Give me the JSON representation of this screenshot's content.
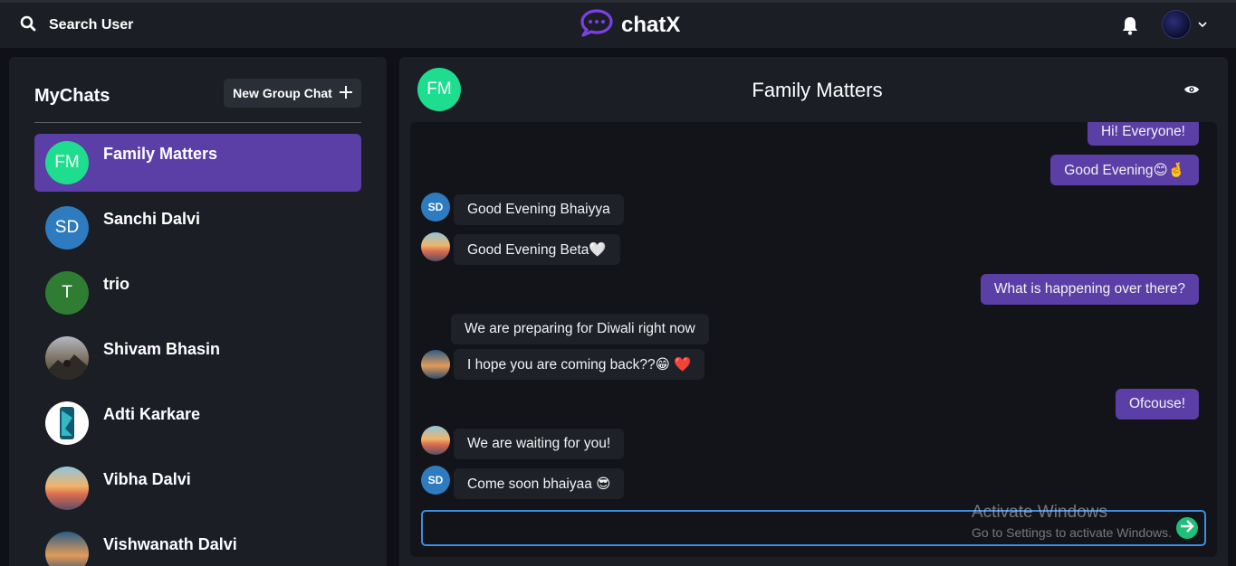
{
  "topbar": {
    "search_label": "Search User",
    "brand_name": "chatX",
    "brand_color": "#7b3fe4"
  },
  "sidebar": {
    "title": "MyChats",
    "new_group_label": "New Group Chat",
    "chats": [
      {
        "name": "Family Matters",
        "initials": "FM",
        "avatar_color": "#1fdd8e",
        "active": true
      },
      {
        "name": "Sanchi Dalvi",
        "initials": "SD",
        "avatar_color": "#2e7bbf",
        "active": false
      },
      {
        "name": "trio",
        "initials": "T",
        "avatar_color": "#2e7d32",
        "active": false
      },
      {
        "name": "Shivam Bhasin",
        "initials": "",
        "avatar_color": "",
        "active": false
      },
      {
        "name": "Adti Karkare",
        "initials": "",
        "avatar_color": "",
        "active": false
      },
      {
        "name": "Vibha Dalvi",
        "initials": "",
        "avatar_color": "",
        "active": false
      },
      {
        "name": "Vishwanath Dalvi",
        "initials": "",
        "avatar_color": "",
        "active": false
      }
    ]
  },
  "chat": {
    "title": "Family Matters",
    "initials": "FM",
    "messages": [
      {
        "text": "Hi! Everyone!",
        "type": "sent"
      },
      {
        "text": "Good Evening😊🤞",
        "type": "sent"
      },
      {
        "text": "Good Evening Bhaiyya",
        "type": "recv",
        "avatar": "SD"
      },
      {
        "text": "Good Evening Beta🤍",
        "type": "recv",
        "avatar": "sunset"
      },
      {
        "text": "What is happening over there?",
        "type": "sent"
      },
      {
        "text": "We are preparing for Diwali right now",
        "type": "recv"
      },
      {
        "text": "I hope you are coming back??😁 ❤️",
        "type": "recv",
        "avatar": "ocean"
      },
      {
        "text": "Ofcouse!",
        "type": "sent"
      },
      {
        "text": "We are waiting for you!",
        "type": "recv",
        "avatar": "sunset"
      },
      {
        "text": "Come soon bhaiyaa 😎",
        "type": "recv",
        "avatar": "SD"
      }
    ],
    "input_value": ""
  },
  "watermark": {
    "line1": "Activate Windows",
    "line2": "Go to Settings to activate Windows."
  },
  "colors": {
    "accent": "#5b3ea6",
    "send_green": "#1fbf78",
    "input_border": "#3c8de0"
  }
}
